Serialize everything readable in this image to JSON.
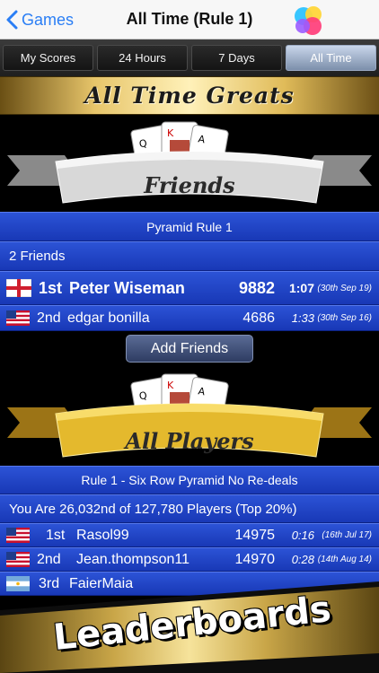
{
  "navbar": {
    "back_label": "Games",
    "title": "All Time (Rule 1)"
  },
  "tabs": [
    {
      "label": "My Scores",
      "active": false
    },
    {
      "label": "24 Hours",
      "active": false
    },
    {
      "label": "7 Days",
      "active": false
    },
    {
      "label": "All Time",
      "active": true
    }
  ],
  "header": {
    "banner_text": "All Time Greats"
  },
  "friends_section": {
    "ribbon_text": "Friends",
    "subtitle": "Pyramid Rule 1",
    "count_label": "2 Friends",
    "rows": [
      {
        "rank": "1st",
        "name": "Peter Wiseman",
        "score": "9882",
        "time": "1:07",
        "date": "(30th Sep 19)",
        "flag": "england"
      },
      {
        "rank": "2nd",
        "name": "edgar bonilla",
        "score": "4686",
        "time": "1:33",
        "date": "(30th Sep 16)",
        "flag": "usa"
      }
    ],
    "add_button": "Add Friends"
  },
  "players_section": {
    "ribbon_text": "All Players",
    "subtitle": "Rule 1 - Six Row Pyramid No Re-deals",
    "position_text": "You Are 26,032nd of 127,780 Players (Top 20%)",
    "rows": [
      {
        "rank": "1st",
        "name": "Rasol99",
        "score": "14975",
        "time": "0:16",
        "date": "(16th Jul 17)",
        "flag": "usa"
      },
      {
        "rank": "2nd",
        "name": "Jean.thompson11",
        "score": "14970",
        "time": "0:28",
        "date": "(14th Aug 14)",
        "flag": "usa"
      },
      {
        "rank": "3rd",
        "name": "FaierMaia",
        "score": "",
        "time": "",
        "date": "",
        "flag": "argentina"
      }
    ]
  },
  "footer": {
    "banner_text": "Leaderboards"
  },
  "colors": {
    "accent": "#2a7ef5",
    "row_blue": "#1f42c6",
    "gold": "#e7c56a"
  }
}
